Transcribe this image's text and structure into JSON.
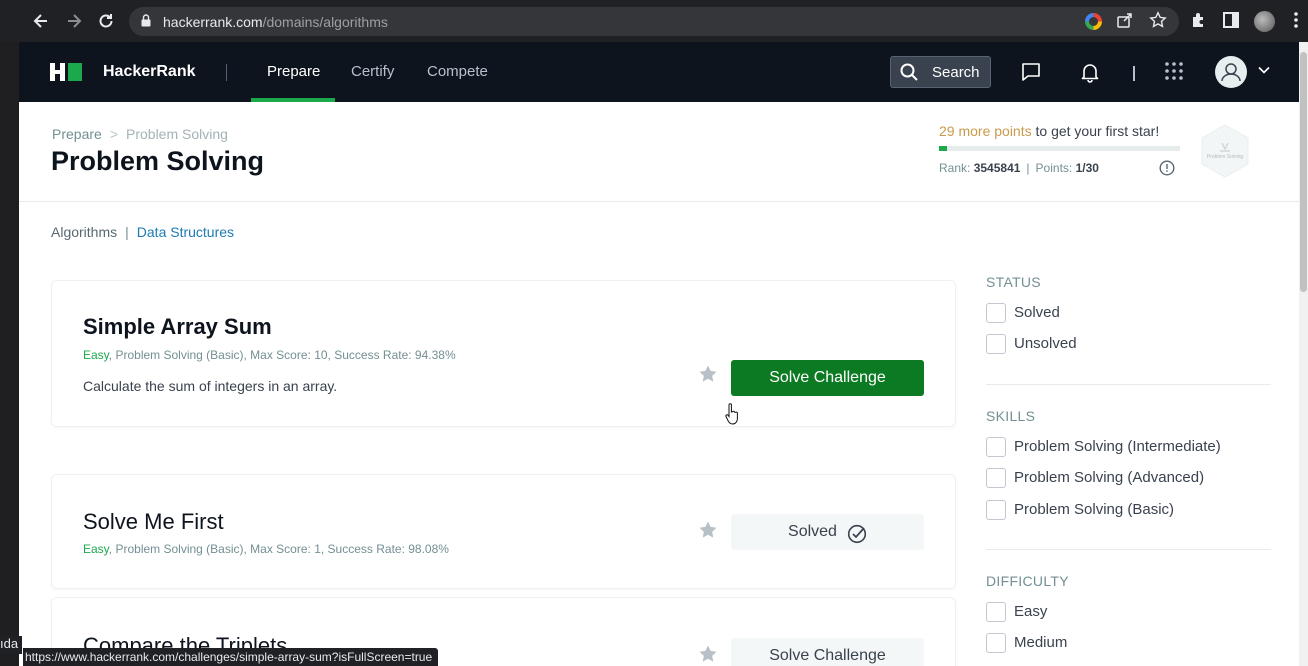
{
  "browser": {
    "url_host": "hackerrank.com",
    "url_path": "/domains/algorithms",
    "status_url": "https://www.hackerrank.com/challenges/simple-array-sum?isFullScreen=true",
    "left_edge_label": "ıda"
  },
  "header": {
    "brand": "HackerRank",
    "tabs": [
      {
        "label": "Prepare",
        "active": true
      },
      {
        "label": "Certify",
        "active": false
      },
      {
        "label": "Compete",
        "active": false
      }
    ],
    "search_label": "Search"
  },
  "breadcrumb": {
    "root": "Prepare",
    "separator": ">",
    "current": "Problem Solving"
  },
  "page_title": "Problem Solving",
  "progress": {
    "points_more": "29 more points",
    "points_suffix": " to get your first star!",
    "fill_fraction": 0.0333,
    "rank_label": "Rank:",
    "rank_value": "3545841",
    "points_label": "Points:",
    "points_value": "1/30",
    "badge_label": "Problem Solving"
  },
  "subdomains": {
    "items": [
      "Algorithms",
      "Data Structures"
    ],
    "separator": "|"
  },
  "challenges": [
    {
      "title": "Simple Array Sum",
      "difficulty": "Easy",
      "meta_rest": ", Problem Solving (Basic), Max Score: 10, Success Rate: 94.38%",
      "description": "Calculate the sum of integers in an array.",
      "button": "Solve Challenge",
      "solved": false
    },
    {
      "title": "Solve Me First",
      "difficulty": "Easy",
      "meta_rest": ", Problem Solving (Basic), Max Score: 1, Success Rate: 98.08%",
      "description": "",
      "button": "Solved",
      "solved": true
    },
    {
      "title": "Compare the Triplets",
      "difficulty": "",
      "meta_rest": "",
      "description": "",
      "button": "Solve Challenge",
      "solved": false
    }
  ],
  "filters": {
    "status": {
      "heading": "STATUS",
      "options": [
        "Solved",
        "Unsolved"
      ]
    },
    "skills": {
      "heading": "SKILLS",
      "options": [
        "Problem Solving (Intermediate)",
        "Problem Solving (Advanced)",
        "Problem Solving (Basic)"
      ]
    },
    "difficulty": {
      "heading": "DIFFICULTY",
      "options": [
        "Easy",
        "Medium"
      ]
    }
  },
  "colors": {
    "header_bg": "#0e141e",
    "accent_green": "#1ba94c",
    "button_green": "#0b7a22",
    "points_gold": "#c99a4b",
    "link_blue": "#1c7bb3"
  }
}
